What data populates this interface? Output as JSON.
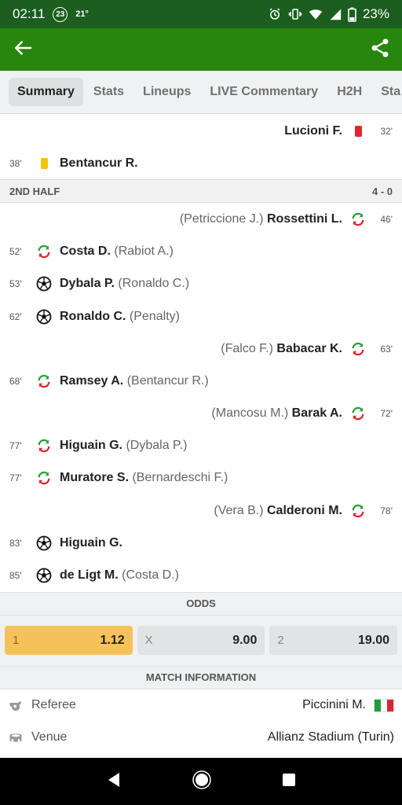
{
  "status_bar": {
    "time": "02:11",
    "notification_badge": "23",
    "temperature": "21°",
    "battery": "23%"
  },
  "app_bar": {
    "back_icon": "arrow-left-icon",
    "share_icon": "share-icon"
  },
  "tabs": [
    {
      "label": "Summary",
      "active": true
    },
    {
      "label": "Stats",
      "active": false
    },
    {
      "label": "Lineups",
      "active": false
    },
    {
      "label": "LIVE Commentary",
      "active": false
    },
    {
      "label": "H2H",
      "active": false
    },
    {
      "label": "Sta",
      "active": false
    }
  ],
  "events_first_half": [
    {
      "side": "away",
      "minute": "32'",
      "type": "red-card",
      "player": "Lucioni F.",
      "assist": ""
    },
    {
      "side": "home",
      "minute": "38'",
      "type": "yellow-card",
      "player": "Bentancur R.",
      "assist": ""
    }
  ],
  "second_half": {
    "label": "2ND HALF",
    "score": "4 - 0"
  },
  "events_second_half": [
    {
      "side": "away",
      "minute": "46'",
      "type": "substitution",
      "player": "Rossettini L.",
      "assist": "(Petriccione J.)"
    },
    {
      "side": "home",
      "minute": "52'",
      "type": "substitution",
      "player": "Costa D.",
      "assist": "(Rabiot A.)"
    },
    {
      "side": "home",
      "minute": "53'",
      "type": "goal",
      "player": "Dybala P.",
      "assist": "(Ronaldo C.)"
    },
    {
      "side": "home",
      "minute": "62'",
      "type": "goal",
      "player": "Ronaldo C.",
      "assist": "(Penalty)"
    },
    {
      "side": "away",
      "minute": "63'",
      "type": "substitution",
      "player": "Babacar K.",
      "assist": "(Falco F.)"
    },
    {
      "side": "home",
      "minute": "68'",
      "type": "substitution",
      "player": "Ramsey A.",
      "assist": "(Bentancur R.)"
    },
    {
      "side": "away",
      "minute": "72'",
      "type": "substitution",
      "player": "Barak A.",
      "assist": "(Mancosu M.)"
    },
    {
      "side": "home",
      "minute": "77'",
      "type": "substitution",
      "player": "Higuain G.",
      "assist": "(Dybala P.)"
    },
    {
      "side": "home",
      "minute": "77'",
      "type": "substitution",
      "player": "Muratore S.",
      "assist": "(Bernardeschi F.)"
    },
    {
      "side": "away",
      "minute": "78'",
      "type": "substitution",
      "player": "Calderoni M.",
      "assist": "(Vera B.)"
    },
    {
      "side": "home",
      "minute": "83'",
      "type": "goal",
      "player": "Higuain G.",
      "assist": ""
    },
    {
      "side": "home",
      "minute": "85'",
      "type": "goal",
      "player": "de Ligt M.",
      "assist": "(Costa D.)"
    }
  ],
  "odds": {
    "header": "ODDS",
    "items": [
      {
        "label": "1",
        "value": "1.12",
        "best": true
      },
      {
        "label": "X",
        "value": "9.00",
        "best": false
      },
      {
        "label": "2",
        "value": "19.00",
        "best": false
      }
    ]
  },
  "match_info": {
    "header": "MATCH INFORMATION",
    "referee_label": "Referee",
    "referee_value": "Piccinini M.",
    "referee_flag_colors": [
      "#1f9d3a",
      "#ffffff",
      "#d9262e"
    ],
    "venue_label": "Venue",
    "venue_value": "Allianz Stadium (Turin)"
  },
  "colors": {
    "status_bar": "#1b5e20",
    "app_bar": "#28850e",
    "best_odd": "#f5c25a",
    "sub_green": "#2e9e3a",
    "sub_red": "#e0262b"
  }
}
